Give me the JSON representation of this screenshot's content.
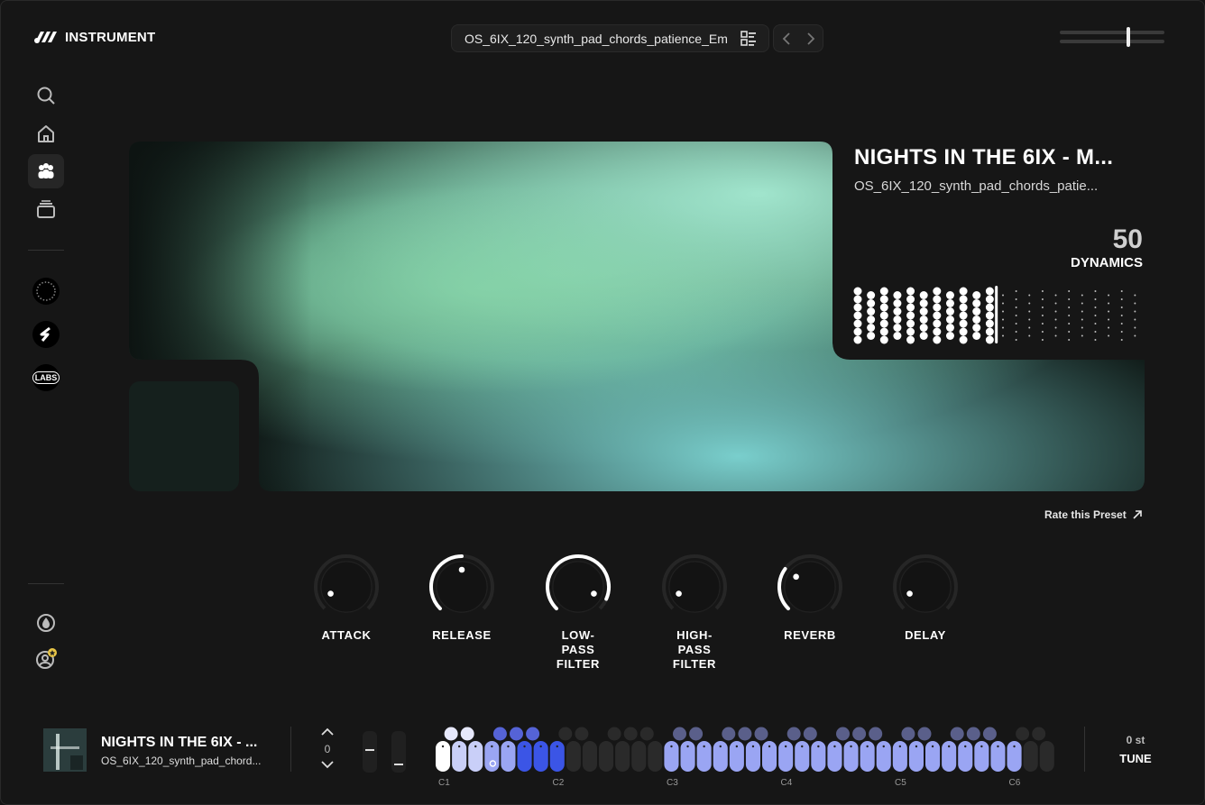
{
  "app": {
    "brand": "INSTRUMENT"
  },
  "header": {
    "preset_name": "OS_6IX_120_synth_pad_chords_patience_Em"
  },
  "sidebar": {
    "items": [
      {
        "name": "search",
        "icon": "search-icon"
      },
      {
        "name": "home",
        "icon": "home-icon"
      },
      {
        "name": "instruments",
        "icon": "users-icon",
        "active": true
      },
      {
        "name": "library",
        "icon": "stack-icon"
      }
    ],
    "brand_items": [
      "ring-logo",
      "s-logo",
      "LABS"
    ]
  },
  "preset_card": {
    "title": "NIGHTS IN THE 6IX - M...",
    "subtitle": "OS_6IX_120_synth_pad_chords_patie...",
    "dynamics_value": "50",
    "dynamics_label": "DYNAMICS",
    "dynamics_level": 0.5
  },
  "rate_link": "Rate this Preset",
  "knobs": [
    {
      "id": "attack",
      "label": "ATTACK",
      "value": 0.08
    },
    {
      "id": "release",
      "label": "RELEASE",
      "value": 0.5
    },
    {
      "id": "lowpass",
      "label": "LOW-\nPASS\nFILTER",
      "value": 0.92
    },
    {
      "id": "highpass",
      "label": "HIGH-\nPASS\nFILTER",
      "value": 0.08
    },
    {
      "id": "reverb",
      "label": "REVERB",
      "value": 0.3
    },
    {
      "id": "delay",
      "label": "DELAY",
      "value": 0.08
    }
  ],
  "now_playing": {
    "title": "NIGHTS IN THE 6IX - ...",
    "subtitle": "OS_6IX_120_synth_pad_chord..."
  },
  "octave": {
    "value": "0"
  },
  "keyboard": {
    "labels": [
      "C1",
      "C2",
      "C3",
      "C4",
      "C5",
      "C6"
    ]
  },
  "tune": {
    "value": "0 st",
    "label": "TUNE"
  },
  "colors": {
    "accent": "#3b55e6",
    "key_light": "#9aa5f3",
    "key_white": "#ffffff",
    "key_dark": "#2a2a2a"
  }
}
